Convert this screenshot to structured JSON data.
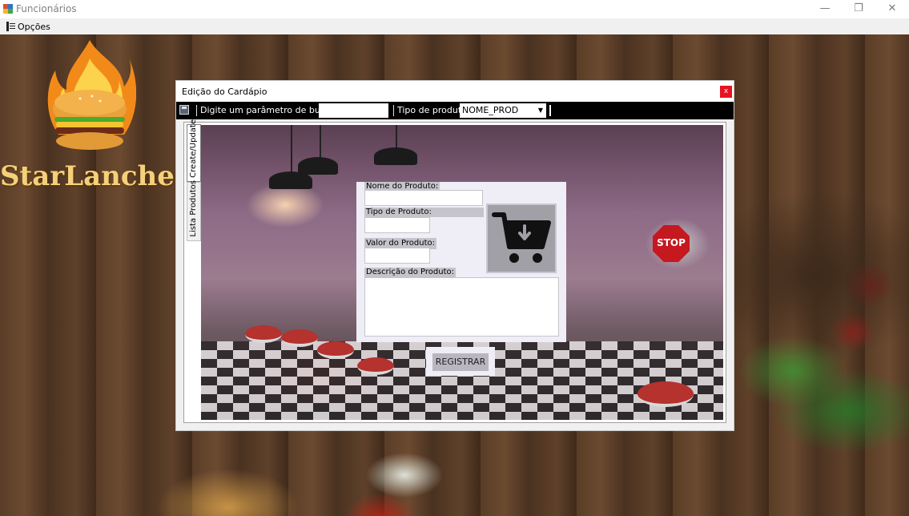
{
  "window": {
    "title": "Funcionários",
    "minimize_glyph": "—",
    "restore_glyph": "❐",
    "close_glyph": "✕"
  },
  "menu": {
    "opcoes_label": "Opções"
  },
  "brand": {
    "name": "StarLanches",
    "color": "#f4d07a"
  },
  "dialog": {
    "title": "Edição do Cardápio",
    "close_glyph": "x",
    "toolbar": {
      "search_label": "Digite um parâmetro de busca:",
      "search_value": "",
      "type_label": "Tipo de produto",
      "type_selected": "NOME_PROD"
    },
    "tabs": [
      {
        "label": "Create/Update",
        "active": true
      },
      {
        "label": "Lista Produtos",
        "active": false
      }
    ],
    "form": {
      "nome_label": "Nome do Produto:",
      "nome_value": "",
      "tipo_label": "Tipo de Produto:",
      "tipo_value": "",
      "valor_label": "Valor do Produto:",
      "valor_value": "",
      "descricao_label": "Descrição do Produto:",
      "descricao_value": "",
      "register_label": "REGISTRAR",
      "cart_icon": "cart-download-icon"
    },
    "scene": {
      "stop_sign": "STOP"
    }
  }
}
